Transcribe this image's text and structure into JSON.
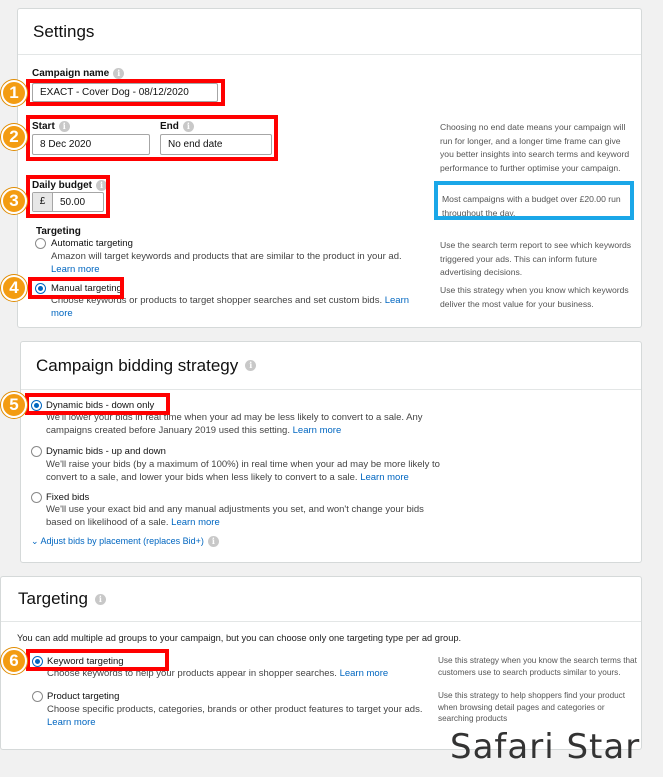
{
  "settings": {
    "title": "Settings",
    "campaign_name_label": "Campaign name",
    "campaign_name_value": "EXACT - Cover Dog - 08/12/2020",
    "start_label": "Start",
    "start_value": "8 Dec 2020",
    "end_label": "End",
    "end_value": "No end date",
    "end_help": "Choosing no end date means your campaign will run for longer, and a longer time frame can give you better insights into search terms and keyword performance to further optimise your campaign.",
    "daily_budget_label": "Daily budget",
    "currency": "£",
    "daily_budget_value": "50.00",
    "budget_help": "Most campaigns with a budget over £20.00 run throughout the day.",
    "targeting_label": "Targeting",
    "auto_label": "Automatic targeting",
    "auto_desc": "Amazon will target keywords and products that are similar to the product in your ad.",
    "auto_learn": "Learn more",
    "auto_help": "Use the search term report to see which keywords triggered your ads. This can inform future advertising decisions.",
    "manual_label": "Manual targeting",
    "manual_desc": "Choose keywords or products to target shopper searches and set custom bids.",
    "manual_learn": "Learn more",
    "manual_help": "Use this strategy when you know which keywords deliver the most value for your business."
  },
  "bidding": {
    "title": "Campaign bidding strategy",
    "down_label": "Dynamic bids - down only",
    "down_desc": "We'll lower your bids in real time when your ad may be less likely to convert to a sale. Any campaigns created before January 2019 used this setting.",
    "down_learn": "Learn more",
    "updown_label": "Dynamic bids - up and down",
    "updown_desc": "We'll raise your bids (by a maximum of 100%) in real time when your ad may be more likely to convert to a sale, and lower your bids when less likely to convert to a sale.",
    "updown_learn": "Learn more",
    "fixed_label": "Fixed bids",
    "fixed_desc": "We'll use your exact bid and any manual adjustments you set, and won't change your bids based on likelihood of a sale.",
    "fixed_learn": "Learn more",
    "adjust_link": "Adjust bids by placement (replaces Bid+)"
  },
  "targeting": {
    "title": "Targeting",
    "intro": "You can add multiple ad groups to your campaign, but you can choose only one targeting type per ad group.",
    "keyword_label": "Keyword targeting",
    "keyword_desc": "Choose keywords to help your products appear in shopper searches.",
    "keyword_learn": "Learn more",
    "keyword_help": "Use this strategy when you know the search terms that customers use to search products similar to yours.",
    "product_label": "Product targeting",
    "product_desc": "Choose specific products, categories, brands or other product features to target your ads.",
    "product_learn": "Learn more",
    "product_help": "Use this strategy to help shoppers find your product when browsing detail pages and categories or searching products"
  },
  "badges": [
    "1",
    "2",
    "3",
    "4",
    "5",
    "6"
  ],
  "watermark": "Safari Star",
  "colors": {
    "highlight_red": "#ff0000",
    "highlight_blue": "#1aa7e8",
    "badge": "#f39c12",
    "link": "#0066c0"
  }
}
